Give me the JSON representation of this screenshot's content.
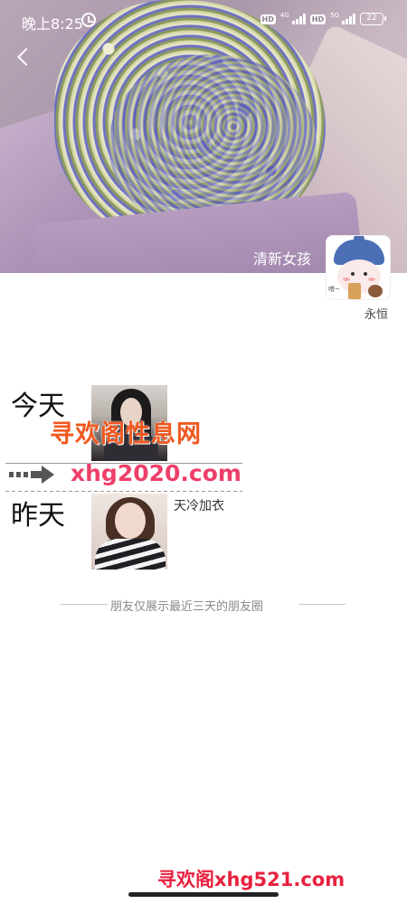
{
  "status_bar": {
    "time": "晚上8:25",
    "hd_1": "HD",
    "net_1": "4G",
    "hd_2": "HD",
    "net_2": "5G",
    "battery": "22"
  },
  "profile": {
    "cover_name": "清新女孩",
    "avatar_name": "永恒",
    "avatar_tag": "喂~"
  },
  "moments": [
    {
      "day": "今天",
      "text": ""
    },
    {
      "day": "昨天",
      "text": "天冷加衣"
    }
  ],
  "footer_note": "朋友仅展示最近三天的朋友圈",
  "watermarks": {
    "site_name": "寻欢阁性息网",
    "site_url": "xhg2020.com",
    "bottom": "寻欢阁xhg521.com"
  },
  "colors": {
    "watermark_orange": "#f0581f",
    "watermark_pink": "#ee3f6a",
    "watermark_red": "#e8213f"
  }
}
